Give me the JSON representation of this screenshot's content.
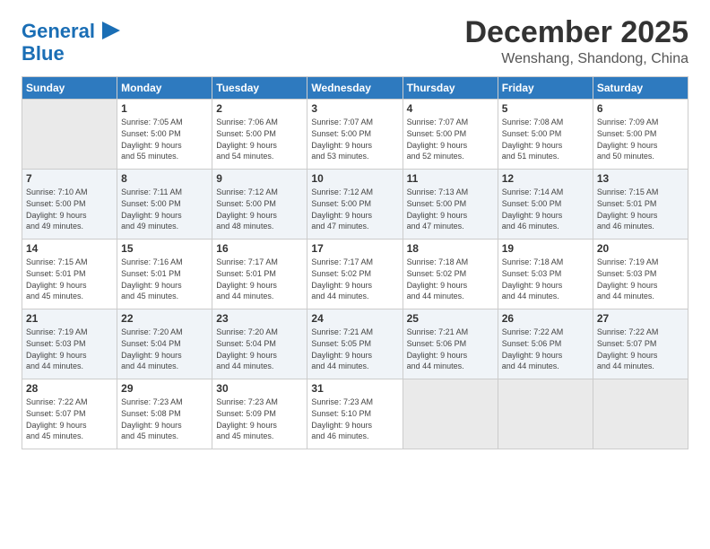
{
  "header": {
    "logo_line1": "General",
    "logo_line2": "Blue",
    "month": "December 2025",
    "location": "Wenshang, Shandong, China"
  },
  "days_of_week": [
    "Sunday",
    "Monday",
    "Tuesday",
    "Wednesday",
    "Thursday",
    "Friday",
    "Saturday"
  ],
  "weeks": [
    [
      {
        "num": "",
        "info": ""
      },
      {
        "num": "1",
        "info": "Sunrise: 7:05 AM\nSunset: 5:00 PM\nDaylight: 9 hours\nand 55 minutes."
      },
      {
        "num": "2",
        "info": "Sunrise: 7:06 AM\nSunset: 5:00 PM\nDaylight: 9 hours\nand 54 minutes."
      },
      {
        "num": "3",
        "info": "Sunrise: 7:07 AM\nSunset: 5:00 PM\nDaylight: 9 hours\nand 53 minutes."
      },
      {
        "num": "4",
        "info": "Sunrise: 7:07 AM\nSunset: 5:00 PM\nDaylight: 9 hours\nand 52 minutes."
      },
      {
        "num": "5",
        "info": "Sunrise: 7:08 AM\nSunset: 5:00 PM\nDaylight: 9 hours\nand 51 minutes."
      },
      {
        "num": "6",
        "info": "Sunrise: 7:09 AM\nSunset: 5:00 PM\nDaylight: 9 hours\nand 50 minutes."
      }
    ],
    [
      {
        "num": "7",
        "info": "Sunrise: 7:10 AM\nSunset: 5:00 PM\nDaylight: 9 hours\nand 49 minutes."
      },
      {
        "num": "8",
        "info": "Sunrise: 7:11 AM\nSunset: 5:00 PM\nDaylight: 9 hours\nand 49 minutes."
      },
      {
        "num": "9",
        "info": "Sunrise: 7:12 AM\nSunset: 5:00 PM\nDaylight: 9 hours\nand 48 minutes."
      },
      {
        "num": "10",
        "info": "Sunrise: 7:12 AM\nSunset: 5:00 PM\nDaylight: 9 hours\nand 47 minutes."
      },
      {
        "num": "11",
        "info": "Sunrise: 7:13 AM\nSunset: 5:00 PM\nDaylight: 9 hours\nand 47 minutes."
      },
      {
        "num": "12",
        "info": "Sunrise: 7:14 AM\nSunset: 5:00 PM\nDaylight: 9 hours\nand 46 minutes."
      },
      {
        "num": "13",
        "info": "Sunrise: 7:15 AM\nSunset: 5:01 PM\nDaylight: 9 hours\nand 46 minutes."
      }
    ],
    [
      {
        "num": "14",
        "info": "Sunrise: 7:15 AM\nSunset: 5:01 PM\nDaylight: 9 hours\nand 45 minutes."
      },
      {
        "num": "15",
        "info": "Sunrise: 7:16 AM\nSunset: 5:01 PM\nDaylight: 9 hours\nand 45 minutes."
      },
      {
        "num": "16",
        "info": "Sunrise: 7:17 AM\nSunset: 5:01 PM\nDaylight: 9 hours\nand 44 minutes."
      },
      {
        "num": "17",
        "info": "Sunrise: 7:17 AM\nSunset: 5:02 PM\nDaylight: 9 hours\nand 44 minutes."
      },
      {
        "num": "18",
        "info": "Sunrise: 7:18 AM\nSunset: 5:02 PM\nDaylight: 9 hours\nand 44 minutes."
      },
      {
        "num": "19",
        "info": "Sunrise: 7:18 AM\nSunset: 5:03 PM\nDaylight: 9 hours\nand 44 minutes."
      },
      {
        "num": "20",
        "info": "Sunrise: 7:19 AM\nSunset: 5:03 PM\nDaylight: 9 hours\nand 44 minutes."
      }
    ],
    [
      {
        "num": "21",
        "info": "Sunrise: 7:19 AM\nSunset: 5:03 PM\nDaylight: 9 hours\nand 44 minutes."
      },
      {
        "num": "22",
        "info": "Sunrise: 7:20 AM\nSunset: 5:04 PM\nDaylight: 9 hours\nand 44 minutes."
      },
      {
        "num": "23",
        "info": "Sunrise: 7:20 AM\nSunset: 5:04 PM\nDaylight: 9 hours\nand 44 minutes."
      },
      {
        "num": "24",
        "info": "Sunrise: 7:21 AM\nSunset: 5:05 PM\nDaylight: 9 hours\nand 44 minutes."
      },
      {
        "num": "25",
        "info": "Sunrise: 7:21 AM\nSunset: 5:06 PM\nDaylight: 9 hours\nand 44 minutes."
      },
      {
        "num": "26",
        "info": "Sunrise: 7:22 AM\nSunset: 5:06 PM\nDaylight: 9 hours\nand 44 minutes."
      },
      {
        "num": "27",
        "info": "Sunrise: 7:22 AM\nSunset: 5:07 PM\nDaylight: 9 hours\nand 44 minutes."
      }
    ],
    [
      {
        "num": "28",
        "info": "Sunrise: 7:22 AM\nSunset: 5:07 PM\nDaylight: 9 hours\nand 45 minutes."
      },
      {
        "num": "29",
        "info": "Sunrise: 7:23 AM\nSunset: 5:08 PM\nDaylight: 9 hours\nand 45 minutes."
      },
      {
        "num": "30",
        "info": "Sunrise: 7:23 AM\nSunset: 5:09 PM\nDaylight: 9 hours\nand 45 minutes."
      },
      {
        "num": "31",
        "info": "Sunrise: 7:23 AM\nSunset: 5:10 PM\nDaylight: 9 hours\nand 46 minutes."
      },
      {
        "num": "",
        "info": ""
      },
      {
        "num": "",
        "info": ""
      },
      {
        "num": "",
        "info": ""
      }
    ]
  ]
}
